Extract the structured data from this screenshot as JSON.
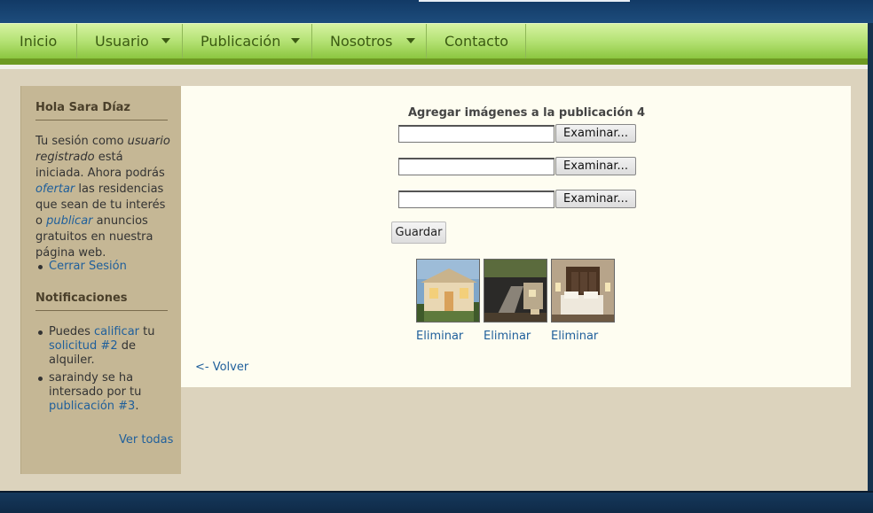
{
  "nav": {
    "items": [
      {
        "label": "Inicio",
        "has_menu": false
      },
      {
        "label": "Usuario",
        "has_menu": true
      },
      {
        "label": "Publicación",
        "has_menu": true
      },
      {
        "label": "Nosotros",
        "has_menu": true
      },
      {
        "label": "Contacto",
        "has_menu": false
      }
    ]
  },
  "sidebar": {
    "greeting": "Hola Sara Díaz",
    "session": {
      "t1": "Tu sesión como ",
      "role": "usuario registrado",
      "t2": " está iniciada. Ahora podrás ",
      "offer_link": "ofertar",
      "t3": " las residencias que sean de tu interés o ",
      "publish_link": "publicar",
      "t4": " anuncios gratuitos en nuestra página web."
    },
    "logout": "Cerrar Sesión",
    "notifications_title": "Notificaciones",
    "notif1": {
      "t1": "Puedes ",
      "link1": "calificar",
      "t2": " tu ",
      "link2": "solicitud #2",
      "t3": " de alquiler."
    },
    "notif2": {
      "t1": "saraindy se ha intersado por tu ",
      "link1": "publicación #3",
      "t2": "."
    },
    "see_all": "Ver todas"
  },
  "main": {
    "title": "Agregar imágenes a la publicación 4",
    "browse_label": "Examinar...",
    "save_label": "Guardar",
    "delete_label": "Eliminar",
    "back_label": "<- Volver"
  },
  "colors": {
    "nav_green": "#b4e274",
    "link_blue": "#1f5f9b",
    "sidebar_bg": "#c5b795",
    "content_bg": "#fefdf1",
    "header_navy": "#123a66"
  }
}
